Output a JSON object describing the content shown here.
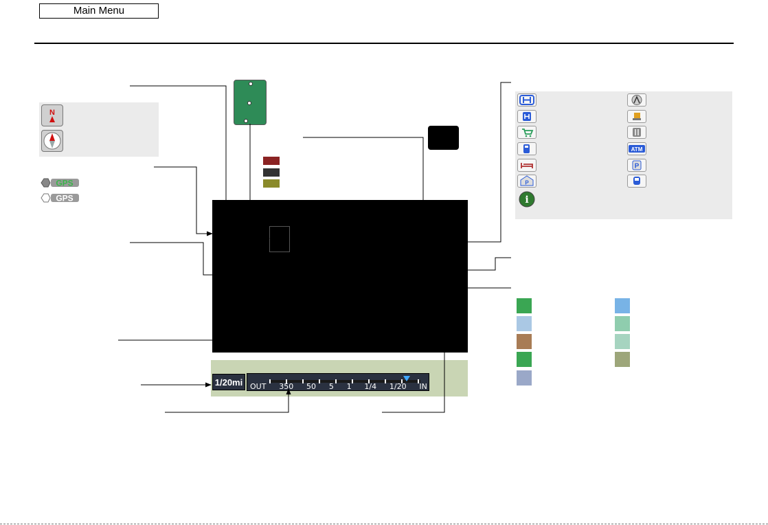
{
  "header": {
    "main_menu_label": "Main Menu"
  },
  "scale_bar": {
    "readout": "1/20mi",
    "labels": [
      "OUT",
      "350",
      "50",
      "5",
      "1",
      "1/4",
      "1/20",
      "IN"
    ],
    "selected_label": "1/20"
  },
  "gps_icons": [
    "GPS",
    "GPS"
  ],
  "icons": {
    "compass": [
      "north-up-icon",
      "heading-up-icon"
    ],
    "landmarks": [
      "honda-dealer-icon",
      "acura-dealer-icon",
      "hospital-icon",
      "school-icon",
      "shopping-icon",
      "restaurant-icon",
      "gas-station-icon",
      "atm-icon",
      "lodging-icon",
      "parking-lot-icon",
      "parking-garage-icon",
      "train-station-icon",
      "information-icon"
    ]
  },
  "atm_icon_label": "ATM",
  "colors": {
    "traffic_red": "#8b2323",
    "traffic_dark": "#333333",
    "traffic_olive": "#8a8a2a",
    "area_swatches": [
      "#3aa653",
      "#78b3e6",
      "#aac8e4",
      "#8fcdae",
      "#a87c55",
      "#a6d4c0",
      "#3aa653",
      "#9da67a",
      "#9aa8c8"
    ]
  }
}
